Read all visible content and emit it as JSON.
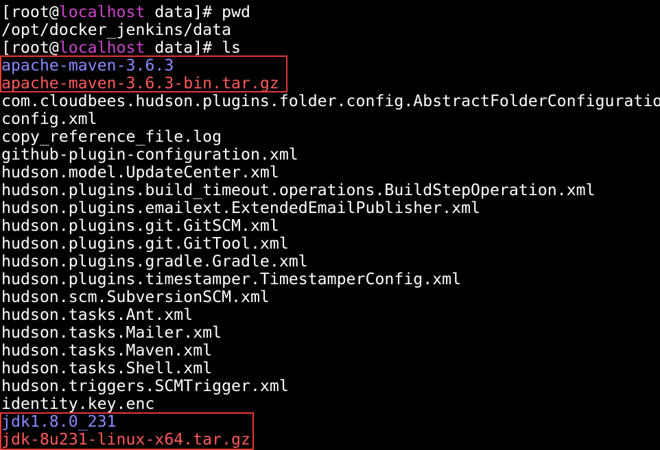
{
  "terminal": {
    "prompt1": {
      "open": "[root@",
      "host": "localhost",
      "rest": " data]# ",
      "command": "pwd"
    },
    "pwd_output": "/opt/docker_jenkins/data",
    "prompt2": {
      "open": "[root@",
      "host": "localhost",
      "rest": " data]# ",
      "command": "ls"
    },
    "listing": [
      {
        "name": "apache-maven-3.6.3",
        "kind": "dir"
      },
      {
        "name": "apache-maven-3.6.3-bin.tar.gz",
        "kind": "archive"
      },
      {
        "name": "com.cloudbees.hudson.plugins.folder.config.AbstractFolderConfiguratio",
        "kind": "file"
      },
      {
        "name": "config.xml",
        "kind": "file"
      },
      {
        "name": "copy_reference_file.log",
        "kind": "file"
      },
      {
        "name": "github-plugin-configuration.xml",
        "kind": "file"
      },
      {
        "name": "hudson.model.UpdateCenter.xml",
        "kind": "file"
      },
      {
        "name": "hudson.plugins.build_timeout.operations.BuildStepOperation.xml",
        "kind": "file"
      },
      {
        "name": "hudson.plugins.emailext.ExtendedEmailPublisher.xml",
        "kind": "file"
      },
      {
        "name": "hudson.plugins.git.GitSCM.xml",
        "kind": "file"
      },
      {
        "name": "hudson.plugins.git.GitTool.xml",
        "kind": "file"
      },
      {
        "name": "hudson.plugins.gradle.Gradle.xml",
        "kind": "file"
      },
      {
        "name": "hudson.plugins.timestamper.TimestamperConfig.xml",
        "kind": "file"
      },
      {
        "name": "hudson.scm.SubversionSCM.xml",
        "kind": "file"
      },
      {
        "name": "hudson.tasks.Ant.xml",
        "kind": "file"
      },
      {
        "name": "hudson.tasks.Mailer.xml",
        "kind": "file"
      },
      {
        "name": "hudson.tasks.Maven.xml",
        "kind": "file"
      },
      {
        "name": "hudson.tasks.Shell.xml",
        "kind": "file"
      },
      {
        "name": "hudson.triggers.SCMTrigger.xml",
        "kind": "file"
      },
      {
        "name": "identity.key.enc",
        "kind": "file"
      },
      {
        "name": "jdk1.8.0_231",
        "kind": "dir"
      },
      {
        "name": "jdk-8u231-linux-x64.tar.gz",
        "kind": "archive"
      }
    ]
  },
  "colors": {
    "background": "#000000",
    "text": "#ffffff",
    "directory": "#8a8aff",
    "archive": "#ff5a5a",
    "hostname": "#cc44cc",
    "highlight_box": "#e53935"
  }
}
